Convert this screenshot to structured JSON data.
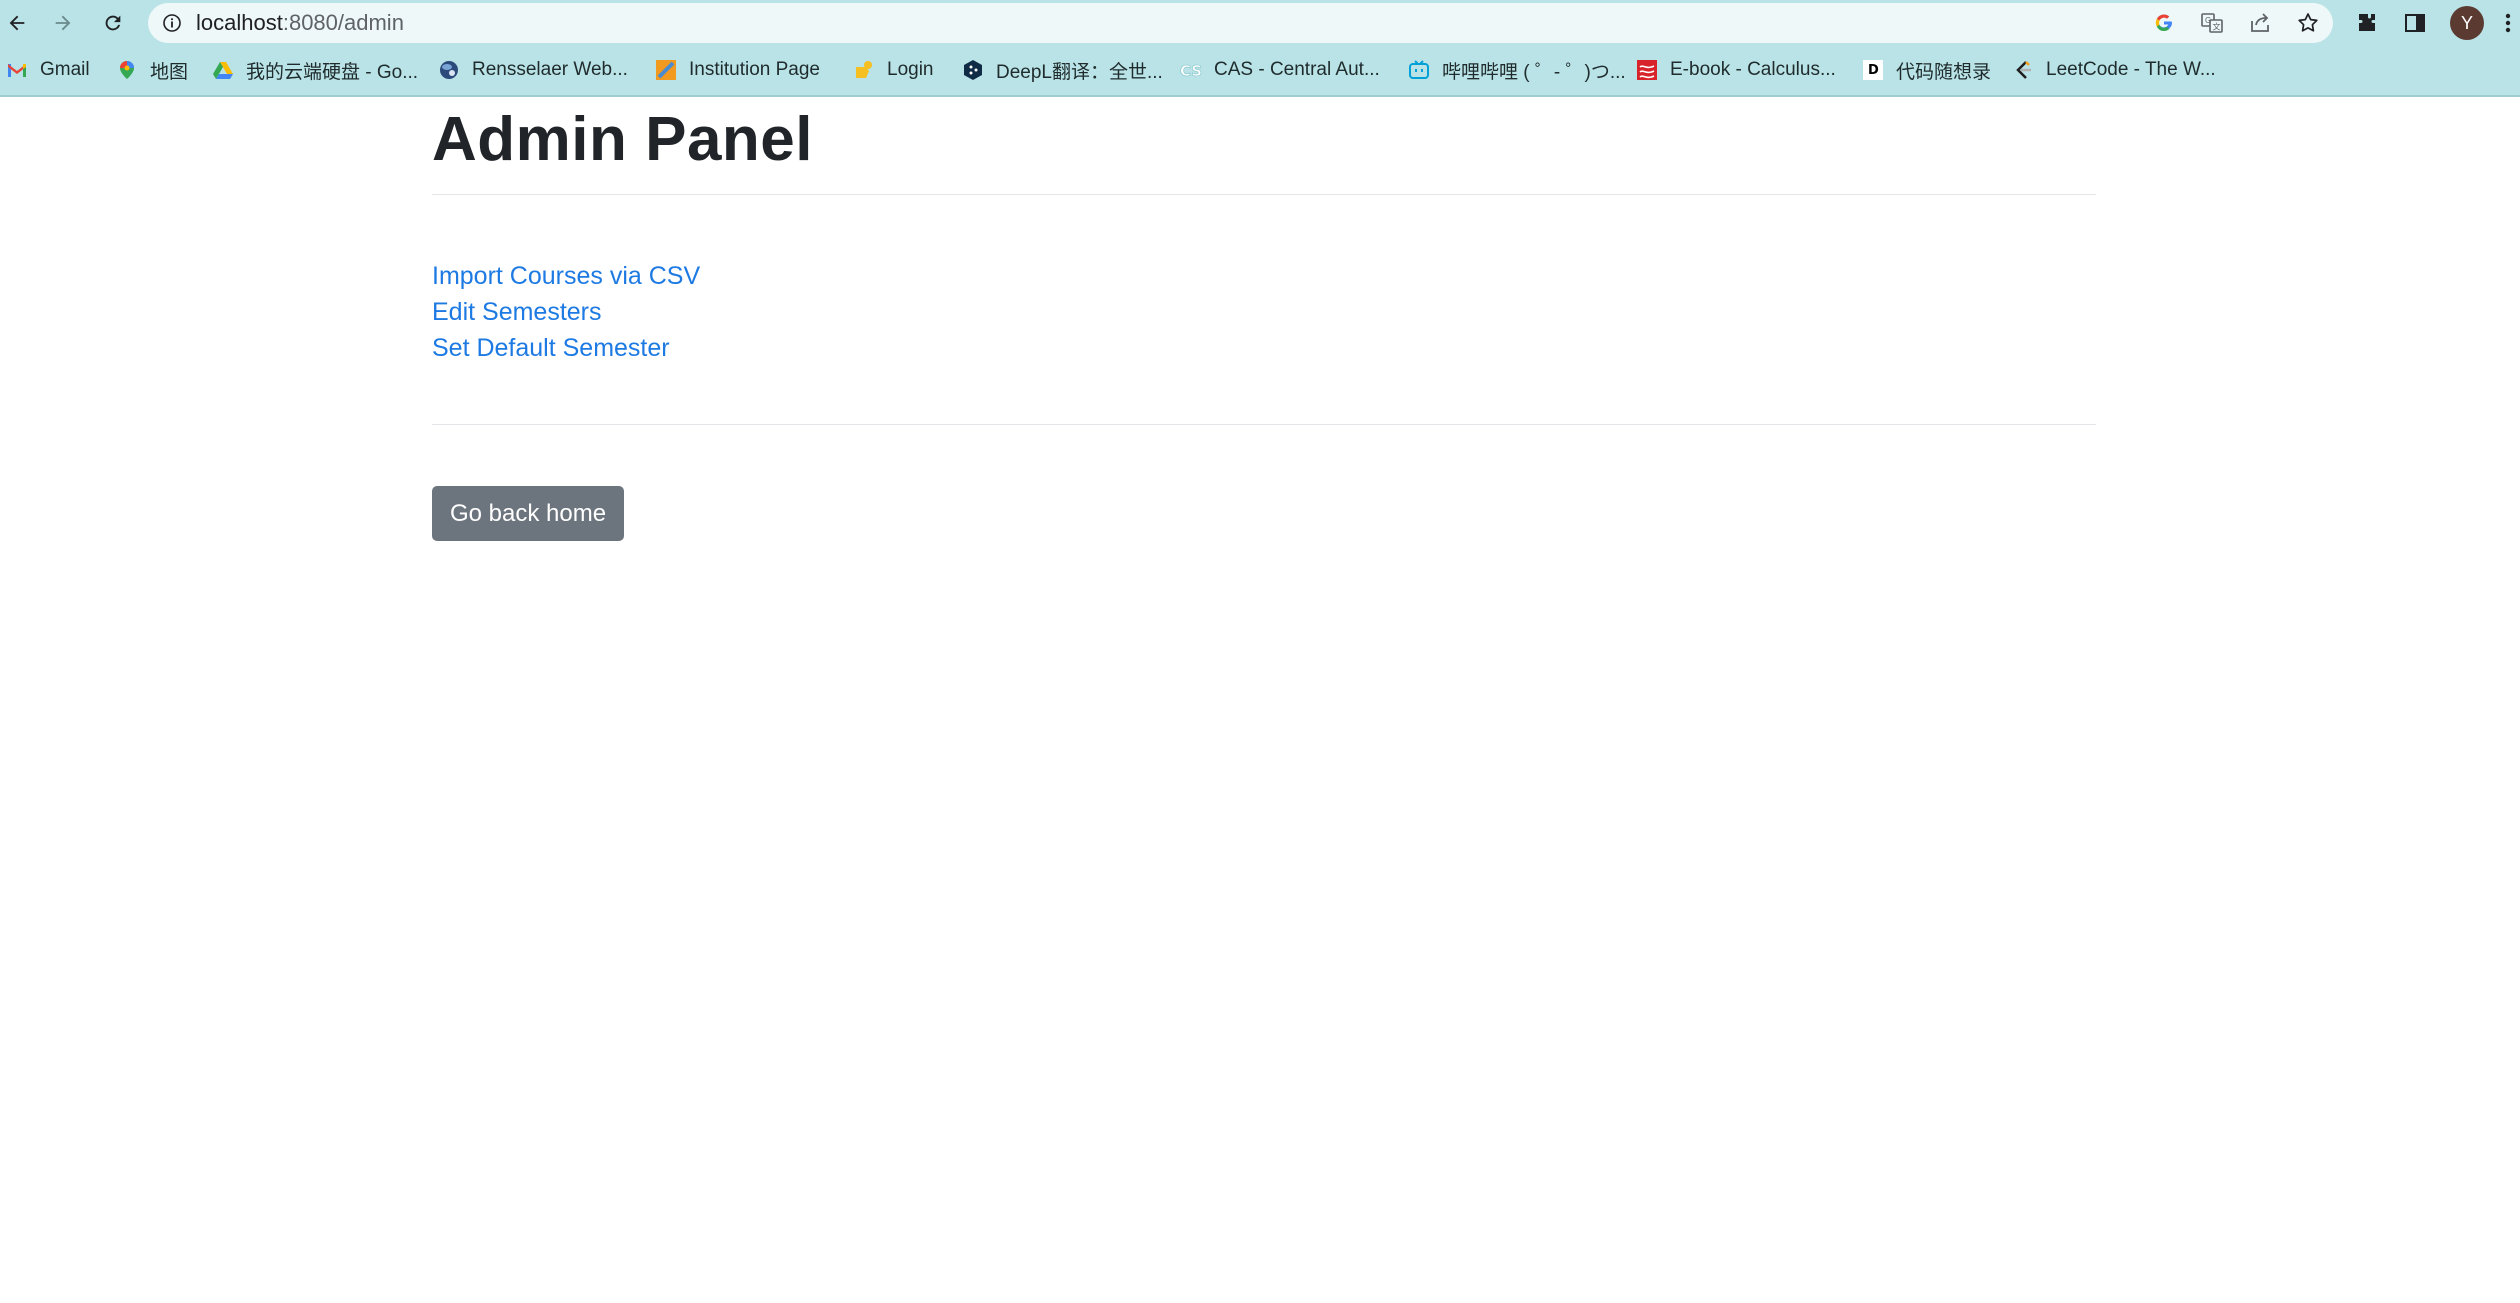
{
  "browser": {
    "url_host": "localhost",
    "url_rest": ":8080/admin",
    "avatar_letter": "Y",
    "accent_color": "#b9e3e6"
  },
  "bookmarks": [
    {
      "label": "Gmail",
      "icon": "gmail-icon"
    },
    {
      "label": "地图",
      "icon": "maps-pin-icon"
    },
    {
      "label": "我的云端硬盘 - Go...",
      "icon": "drive-icon"
    },
    {
      "label": "Rensselaer Web...",
      "icon": "globe-icon"
    },
    {
      "label": "Institution Page",
      "icon": "institution-icon"
    },
    {
      "label": "Login",
      "icon": "login-icon"
    },
    {
      "label": "DeepL翻译：全世...",
      "icon": "deepl-icon"
    },
    {
      "label": "CAS - Central Aut...",
      "icon": "cas-icon"
    },
    {
      "label": "哔哩哔哩 ( ゜- ゜)つ...",
      "icon": "bilibili-icon"
    },
    {
      "label": "E-book - Calculus...",
      "icon": "ebook-icon"
    },
    {
      "label": "代码随想录",
      "icon": "code-icon"
    },
    {
      "label": "LeetCode - The W...",
      "icon": "leetcode-icon"
    }
  ],
  "main": {
    "title": "Admin Panel",
    "links": [
      {
        "label": "Import Courses via CSV"
      },
      {
        "label": "Edit Semesters"
      },
      {
        "label": "Set Default Semester"
      }
    ],
    "home_button": "Go back home",
    "link_color": "#1d7ae3",
    "button_color": "#6c757d"
  }
}
